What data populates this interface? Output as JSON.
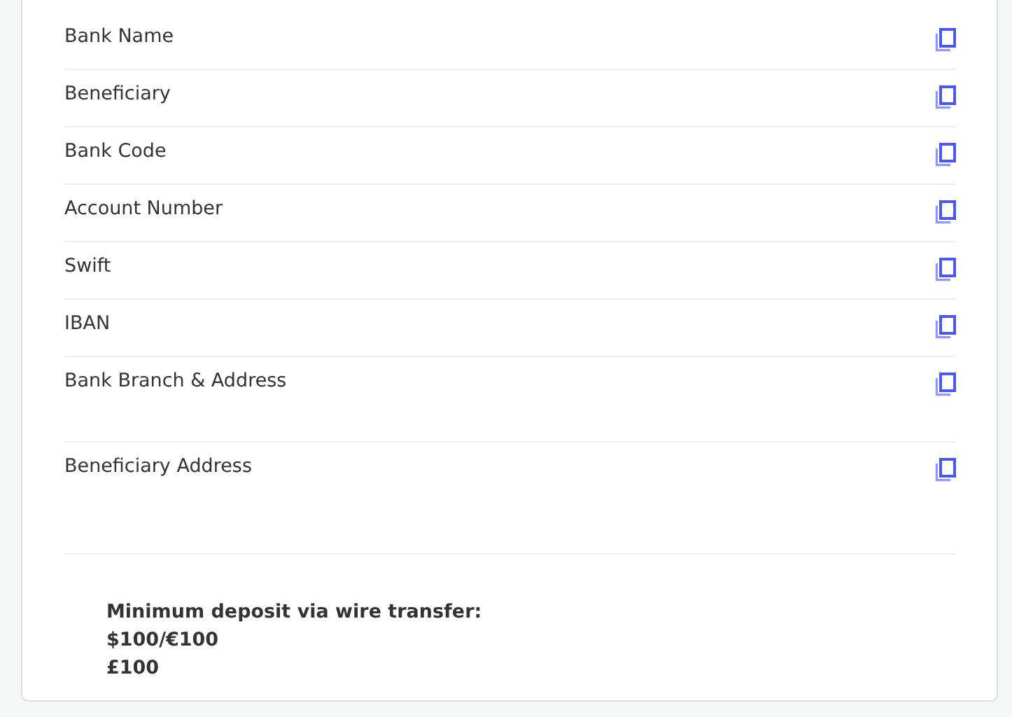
{
  "fields": [
    {
      "label": "Bank Name"
    },
    {
      "label": "Beneficiary"
    },
    {
      "label": "Bank Code"
    },
    {
      "label": "Account Number"
    },
    {
      "label": "Swift"
    },
    {
      "label": "IBAN"
    },
    {
      "label": "Bank Branch & Address"
    },
    {
      "label": "Beneficiary Address"
    }
  ],
  "minimum_deposit": {
    "lines": [
      "Minimum deposit via wire transfer:",
      "$100/€100",
      "£100"
    ]
  }
}
